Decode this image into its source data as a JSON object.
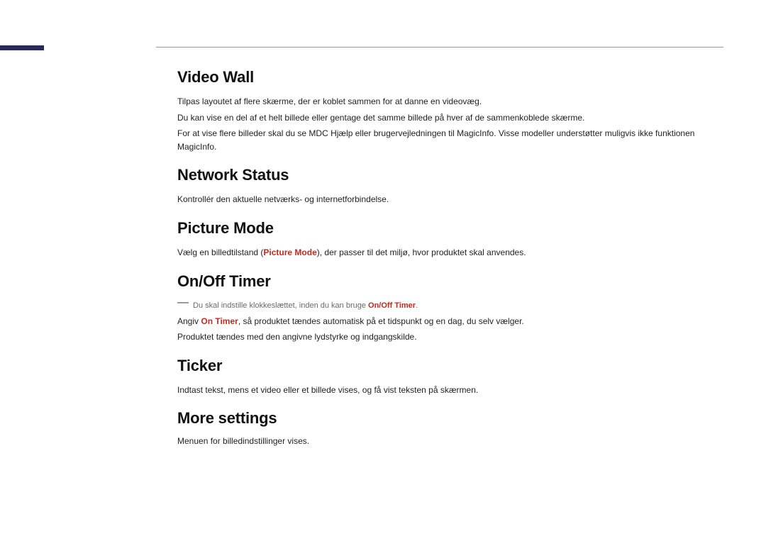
{
  "sections": {
    "videoWall": {
      "heading": "Video Wall",
      "p1": "Tilpas layoutet af flere skærme, der er koblet sammen for at danne en videovæg.",
      "p2": "Du kan vise en del af et helt billede eller gentage det samme billede på hver af de sammenkoblede skærme.",
      "p3": "For at vise flere billeder skal du se MDC Hjælp eller brugervejledningen til MagicInfo. Visse modeller understøtter muligvis ikke funktionen MagicInfo."
    },
    "networkStatus": {
      "heading": "Network Status",
      "p1": "Kontrollér den aktuelle netværks- og internetforbindelse."
    },
    "pictureMode": {
      "heading": "Picture Mode",
      "p1_a": "Vælg en billedtilstand (",
      "p1_bold": "Picture Mode",
      "p1_b": "), der passer til det miljø, hvor produktet skal anvendes."
    },
    "onOffTimer": {
      "heading": "On/Off Timer",
      "note_a": "Du skal indstille klokkeslættet, inden du kan bruge ",
      "note_bold": "On/Off Timer",
      "note_b": ".",
      "p1_a": "Angiv ",
      "p1_bold": "On Timer",
      "p1_b": ", så produktet tændes automatisk på et tidspunkt og en dag, du selv vælger.",
      "p2": "Produktet tændes med den angivne lydstyrke og indgangskilde."
    },
    "ticker": {
      "heading": "Ticker",
      "p1": "Indtast tekst, mens et video eller et billede vises, og få vist teksten på skærmen."
    },
    "moreSettings": {
      "heading": "More settings",
      "p1": "Menuen for billedindstillinger vises."
    }
  }
}
